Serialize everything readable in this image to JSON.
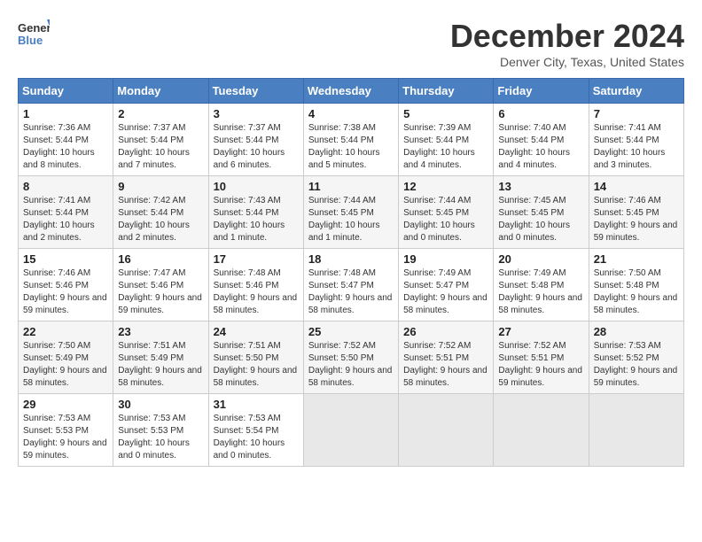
{
  "logo": {
    "line1": "General",
    "line2": "Blue"
  },
  "title": "December 2024",
  "location": "Denver City, Texas, United States",
  "days_of_week": [
    "Sunday",
    "Monday",
    "Tuesday",
    "Wednesday",
    "Thursday",
    "Friday",
    "Saturday"
  ],
  "weeks": [
    [
      {
        "day": "1",
        "sunrise": "7:36 AM",
        "sunset": "5:44 PM",
        "daylight": "10 hours and 8 minutes."
      },
      {
        "day": "2",
        "sunrise": "7:37 AM",
        "sunset": "5:44 PM",
        "daylight": "10 hours and 7 minutes."
      },
      {
        "day": "3",
        "sunrise": "7:37 AM",
        "sunset": "5:44 PM",
        "daylight": "10 hours and 6 minutes."
      },
      {
        "day": "4",
        "sunrise": "7:38 AM",
        "sunset": "5:44 PM",
        "daylight": "10 hours and 5 minutes."
      },
      {
        "day": "5",
        "sunrise": "7:39 AM",
        "sunset": "5:44 PM",
        "daylight": "10 hours and 4 minutes."
      },
      {
        "day": "6",
        "sunrise": "7:40 AM",
        "sunset": "5:44 PM",
        "daylight": "10 hours and 4 minutes."
      },
      {
        "day": "7",
        "sunrise": "7:41 AM",
        "sunset": "5:44 PM",
        "daylight": "10 hours and 3 minutes."
      }
    ],
    [
      {
        "day": "8",
        "sunrise": "7:41 AM",
        "sunset": "5:44 PM",
        "daylight": "10 hours and 2 minutes."
      },
      {
        "day": "9",
        "sunrise": "7:42 AM",
        "sunset": "5:44 PM",
        "daylight": "10 hours and 2 minutes."
      },
      {
        "day": "10",
        "sunrise": "7:43 AM",
        "sunset": "5:44 PM",
        "daylight": "10 hours and 1 minute."
      },
      {
        "day": "11",
        "sunrise": "7:44 AM",
        "sunset": "5:45 PM",
        "daylight": "10 hours and 1 minute."
      },
      {
        "day": "12",
        "sunrise": "7:44 AM",
        "sunset": "5:45 PM",
        "daylight": "10 hours and 0 minutes."
      },
      {
        "day": "13",
        "sunrise": "7:45 AM",
        "sunset": "5:45 PM",
        "daylight": "10 hours and 0 minutes."
      },
      {
        "day": "14",
        "sunrise": "7:46 AM",
        "sunset": "5:45 PM",
        "daylight": "9 hours and 59 minutes."
      }
    ],
    [
      {
        "day": "15",
        "sunrise": "7:46 AM",
        "sunset": "5:46 PM",
        "daylight": "9 hours and 59 minutes."
      },
      {
        "day": "16",
        "sunrise": "7:47 AM",
        "sunset": "5:46 PM",
        "daylight": "9 hours and 59 minutes."
      },
      {
        "day": "17",
        "sunrise": "7:48 AM",
        "sunset": "5:46 PM",
        "daylight": "9 hours and 58 minutes."
      },
      {
        "day": "18",
        "sunrise": "7:48 AM",
        "sunset": "5:47 PM",
        "daylight": "9 hours and 58 minutes."
      },
      {
        "day": "19",
        "sunrise": "7:49 AM",
        "sunset": "5:47 PM",
        "daylight": "9 hours and 58 minutes."
      },
      {
        "day": "20",
        "sunrise": "7:49 AM",
        "sunset": "5:48 PM",
        "daylight": "9 hours and 58 minutes."
      },
      {
        "day": "21",
        "sunrise": "7:50 AM",
        "sunset": "5:48 PM",
        "daylight": "9 hours and 58 minutes."
      }
    ],
    [
      {
        "day": "22",
        "sunrise": "7:50 AM",
        "sunset": "5:49 PM",
        "daylight": "9 hours and 58 minutes."
      },
      {
        "day": "23",
        "sunrise": "7:51 AM",
        "sunset": "5:49 PM",
        "daylight": "9 hours and 58 minutes."
      },
      {
        "day": "24",
        "sunrise": "7:51 AM",
        "sunset": "5:50 PM",
        "daylight": "9 hours and 58 minutes."
      },
      {
        "day": "25",
        "sunrise": "7:52 AM",
        "sunset": "5:50 PM",
        "daylight": "9 hours and 58 minutes."
      },
      {
        "day": "26",
        "sunrise": "7:52 AM",
        "sunset": "5:51 PM",
        "daylight": "9 hours and 58 minutes."
      },
      {
        "day": "27",
        "sunrise": "7:52 AM",
        "sunset": "5:51 PM",
        "daylight": "9 hours and 59 minutes."
      },
      {
        "day": "28",
        "sunrise": "7:53 AM",
        "sunset": "5:52 PM",
        "daylight": "9 hours and 59 minutes."
      }
    ],
    [
      {
        "day": "29",
        "sunrise": "7:53 AM",
        "sunset": "5:53 PM",
        "daylight": "9 hours and 59 minutes."
      },
      {
        "day": "30",
        "sunrise": "7:53 AM",
        "sunset": "5:53 PM",
        "daylight": "10 hours and 0 minutes."
      },
      {
        "day": "31",
        "sunrise": "7:53 AM",
        "sunset": "5:54 PM",
        "daylight": "10 hours and 0 minutes."
      },
      null,
      null,
      null,
      null
    ]
  ]
}
